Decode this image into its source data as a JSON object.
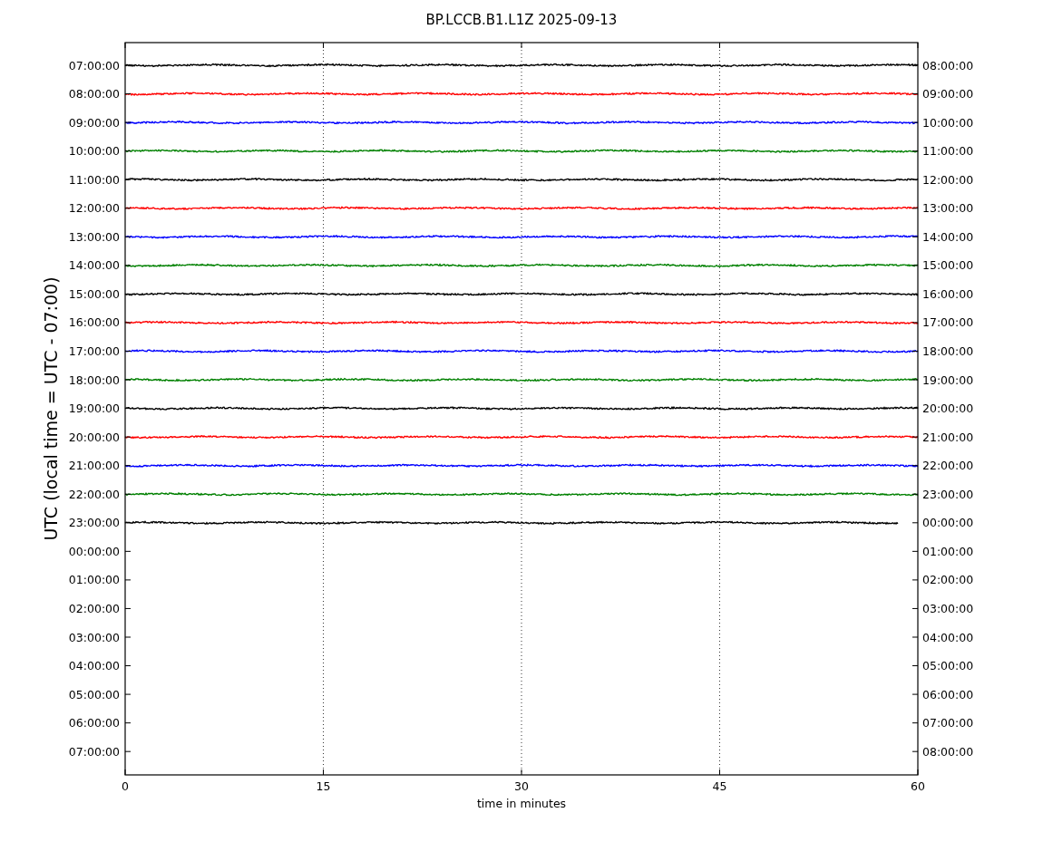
{
  "chart": {
    "title": "BP.LCCB.B1.L1Z 2025-09-13",
    "xlabel": "time in minutes",
    "ylabel": "UTC (local time = UTC - 07:00)",
    "x_axis_labels": [
      "0",
      "15",
      "30",
      "45",
      "60"
    ],
    "grid": true,
    "left_axis_labels": [
      "07:00:00",
      "08:00:00",
      "09:00:00",
      "10:00:00",
      "11:00:00",
      "12:00:00",
      "13:00:00",
      "14:00:00",
      "15:00:00",
      "16:00:00",
      "17:00:00",
      "18:00:00",
      "19:00:00",
      "20:00:00",
      "21:00:00",
      "22:00:00",
      "23:00:00",
      "00:00:00",
      "01:00:00",
      "02:00:00",
      "03:00:00",
      "04:00:00",
      "05:00:00",
      "06:00:00",
      "07:00:00"
    ],
    "right_axis_labels": [
      "08:00:00",
      "09:00:00",
      "10:00:00",
      "11:00:00",
      "12:00:00",
      "13:00:00",
      "14:00:00",
      "15:00:00",
      "16:00:00",
      "17:00:00",
      "18:00:00",
      "19:00:00",
      "20:00:00",
      "21:00:00",
      "22:00:00",
      "23:00:00",
      "00:00:00",
      "01:00:00",
      "02:00:00",
      "03:00:00",
      "04:00:00",
      "05:00:00",
      "06:00:00",
      "07:00:00",
      "08:00:00"
    ],
    "traces": [
      {
        "color": "#000000",
        "complete": true
      },
      {
        "color": "#ff0000",
        "complete": true
      },
      {
        "color": "#0000ff",
        "complete": true
      },
      {
        "color": "#008000",
        "complete": true
      },
      {
        "color": "#000000",
        "complete": true
      },
      {
        "color": "#ff0000",
        "complete": true
      },
      {
        "color": "#0000ff",
        "complete": true
      },
      {
        "color": "#008000",
        "complete": true
      },
      {
        "color": "#000000",
        "complete": true
      },
      {
        "color": "#ff0000",
        "complete": true
      },
      {
        "color": "#0000ff",
        "complete": true
      },
      {
        "color": "#008000",
        "complete": true
      },
      {
        "color": "#000000",
        "complete": true
      },
      {
        "color": "#ff0000",
        "complete": true
      },
      {
        "color": "#0000ff",
        "complete": true
      },
      {
        "color": "#008000",
        "complete": true
      },
      {
        "color": "#000000",
        "complete": false
      }
    ]
  }
}
